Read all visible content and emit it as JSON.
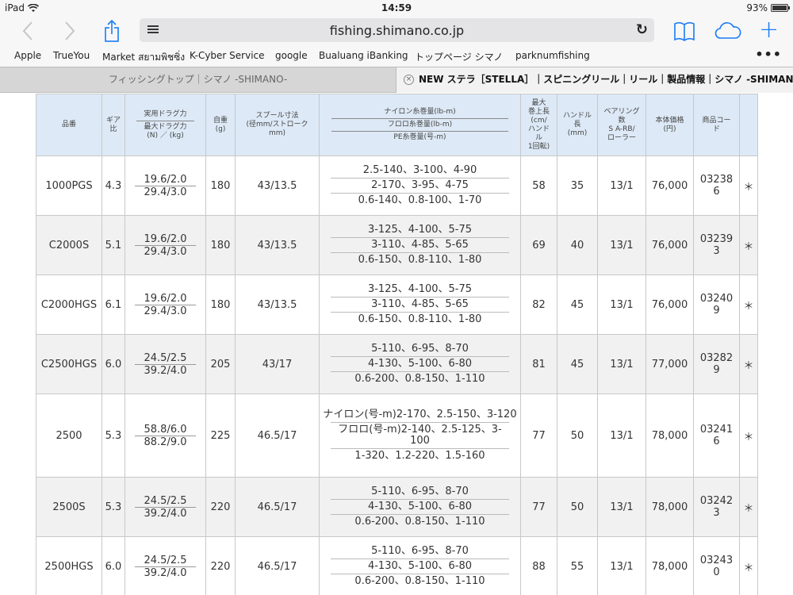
{
  "status_bar": {
    "device": "iPad",
    "time": "14:59",
    "battery": "93%"
  },
  "toolbar": {
    "back_glyph": "‹",
    "forward_glyph": "›",
    "url": "fishing.shimano.co.jp",
    "reload_glyph": "↻",
    "add_glyph": "+"
  },
  "bookmarks": [
    "Apple",
    "TrueYou",
    "Market สยามพิชซิ่ง",
    "K-Cyber Service",
    "google",
    "Bualuang iBanking",
    "トップページ シマノ",
    "parknumfishing"
  ],
  "bookmarks_more": "•••",
  "tabs": {
    "inactive": "フィッシングトップ｜シマノ -SHIMANO-",
    "active": "NEW ステラ［STELLA］｜スピニングリール｜リール｜製品情報｜シマノ -SHIMAN…",
    "close_glyph": "×"
  },
  "table": {
    "headers": {
      "model": "品番",
      "gear": [
        "ギア",
        "比"
      ],
      "drag_top": "実用ドラグ力",
      "drag_bottom": "最大ドラグ力",
      "drag_unit": "(N) ／ (kg)",
      "weight": [
        "自重",
        "(g)"
      ],
      "spool": [
        "スプール寸法",
        "(径mm/ストローク",
        "mm)"
      ],
      "line1": "ナイロン糸巻量(lb-m)",
      "line2": "フロロ糸巻量(lb-m)",
      "line3": "PE糸巻量(号-m)",
      "retrieve": [
        "最大",
        "巻上長",
        "(cm/",
        "ハンド",
        "ル",
        "1回転)"
      ],
      "handle": [
        "ハンドル",
        "長",
        "(mm)"
      ],
      "bearing": [
        "ベアリング",
        "数",
        "S A-RB/",
        "ローラー"
      ],
      "price": [
        "本体価格",
        "(円)"
      ],
      "code": [
        "商品コー",
        "ド"
      ]
    },
    "rows": [
      {
        "model": "1000PGS",
        "gear": "4.3",
        "drag_practical": "19.6/2.0",
        "drag_max": "29.4/3.0",
        "weight": "180",
        "spool": "43/13.5",
        "lines": [
          "2.5-140、3-100、4-90",
          "2-170、3-95、4-75",
          "0.6-140、0.8-100、1-70"
        ],
        "retrieve": "58",
        "handle": "35",
        "bearing": "13/1",
        "price": "76,000",
        "code": [
          "03238",
          "6"
        ],
        "mark": "＊"
      },
      {
        "model": "C2000S",
        "gear": "5.1",
        "drag_practical": "19.6/2.0",
        "drag_max": "29.4/3.0",
        "weight": "180",
        "spool": "43/13.5",
        "lines": [
          "3-125、4-100、5-75",
          "3-110、4-85、5-65",
          "0.6-150、0.8-110、1-80"
        ],
        "retrieve": "69",
        "handle": "40",
        "bearing": "13/1",
        "price": "76,000",
        "code": [
          "03239",
          "3"
        ],
        "mark": "＊"
      },
      {
        "model": "C2000HGS",
        "gear": "6.1",
        "drag_practical": "19.6/2.0",
        "drag_max": "29.4/3.0",
        "weight": "180",
        "spool": "43/13.5",
        "lines": [
          "3-125、4-100、5-75",
          "3-110、4-85、5-65",
          "0.6-150、0.8-110、1-80"
        ],
        "retrieve": "82",
        "handle": "45",
        "bearing": "13/1",
        "price": "76,000",
        "code": [
          "03240",
          "9"
        ],
        "mark": "＊"
      },
      {
        "model": "C2500HGS",
        "gear": "6.0",
        "drag_practical": "24.5/2.5",
        "drag_max": "39.2/4.0",
        "weight": "205",
        "spool": "43/17",
        "lines": [
          "5-110、6-95、8-70",
          "4-130、5-100、6-80",
          "0.6-200、0.8-150、1-110"
        ],
        "retrieve": "81",
        "handle": "45",
        "bearing": "13/1",
        "price": "77,000",
        "code": [
          "03282",
          "9"
        ],
        "mark": "＊"
      },
      {
        "model": "2500",
        "gear": "5.3",
        "drag_practical": "58.8/6.0",
        "drag_max": "88.2/9.0",
        "weight": "225",
        "spool": "46.5/17",
        "lines": [
          "ナイロン(号-m)2-170、2.5-150、3-120",
          "フロロ(号-m)2-140、2.5-125、3-100",
          "1-320、1.2-220、1.5-160"
        ],
        "retrieve": "77",
        "handle": "50",
        "bearing": "13/1",
        "price": "78,000",
        "code": [
          "03241",
          "6"
        ],
        "mark": "＊"
      },
      {
        "model": "2500S",
        "gear": "5.3",
        "drag_practical": "24.5/2.5",
        "drag_max": "39.2/4.0",
        "weight": "220",
        "spool": "46.5/17",
        "lines": [
          "5-110、6-95、8-70",
          "4-130、5-100、6-80",
          "0.6-200、0.8-150、1-110"
        ],
        "retrieve": "77",
        "handle": "50",
        "bearing": "13/1",
        "price": "78,000",
        "code": [
          "03242",
          "3"
        ],
        "mark": "＊"
      },
      {
        "model": "2500HGS",
        "gear": "6.0",
        "drag_practical": "24.5/2.5",
        "drag_max": "39.2/4.0",
        "weight": "220",
        "spool": "46.5/17",
        "lines": [
          "5-110、6-95、8-70",
          "4-130、5-100、6-80",
          "0.6-200、0.8-150、1-110"
        ],
        "retrieve": "88",
        "handle": "55",
        "bearing": "13/1",
        "price": "78,000",
        "code": [
          "03243",
          "0"
        ],
        "mark": "＊"
      }
    ]
  }
}
